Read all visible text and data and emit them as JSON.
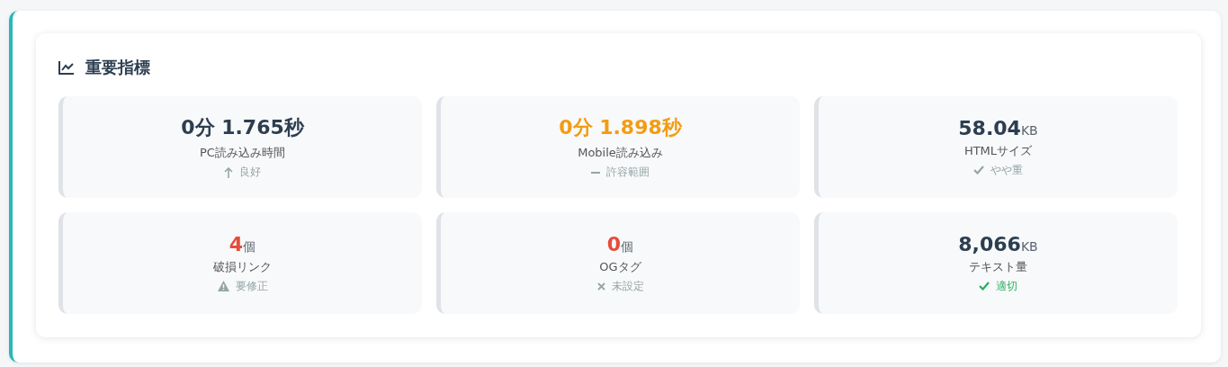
{
  "section": {
    "title": "重要指標"
  },
  "metrics": [
    {
      "value": "0分 1.765秒",
      "color": "#2c3e50",
      "label": "PC読み込み時間",
      "status": {
        "kind": "arrow-up",
        "text": "良好",
        "color": "#95a5a6"
      }
    },
    {
      "value": "0分 1.898秒",
      "color": "#f39c12",
      "label": "Mobile読み込み",
      "status": {
        "kind": "dash",
        "text": "許容範囲",
        "color": "#95a5a6"
      }
    },
    {
      "value": "58.04",
      "unit": "KB",
      "color": "#2c3e50",
      "label": "HTMLサイズ",
      "status": {
        "kind": "check",
        "text": "やや重",
        "color": "#95a5a6"
      }
    },
    {
      "value": "4",
      "unit": "個",
      "color": "#e74c3c",
      "label": "破損リンク",
      "status": {
        "kind": "warning",
        "text": "要修正",
        "color": "#95a5a6"
      }
    },
    {
      "value": "0",
      "unit": "個",
      "color": "#e74c3c",
      "label": "OGタグ",
      "status": {
        "kind": "cross",
        "text": "未設定",
        "color": "#95a5a6"
      }
    },
    {
      "value": "8,066",
      "unit": "KB",
      "color": "#2c3e50",
      "label": "テキスト量",
      "status": {
        "kind": "check",
        "text": "適切",
        "color": "#27ae60"
      }
    }
  ]
}
